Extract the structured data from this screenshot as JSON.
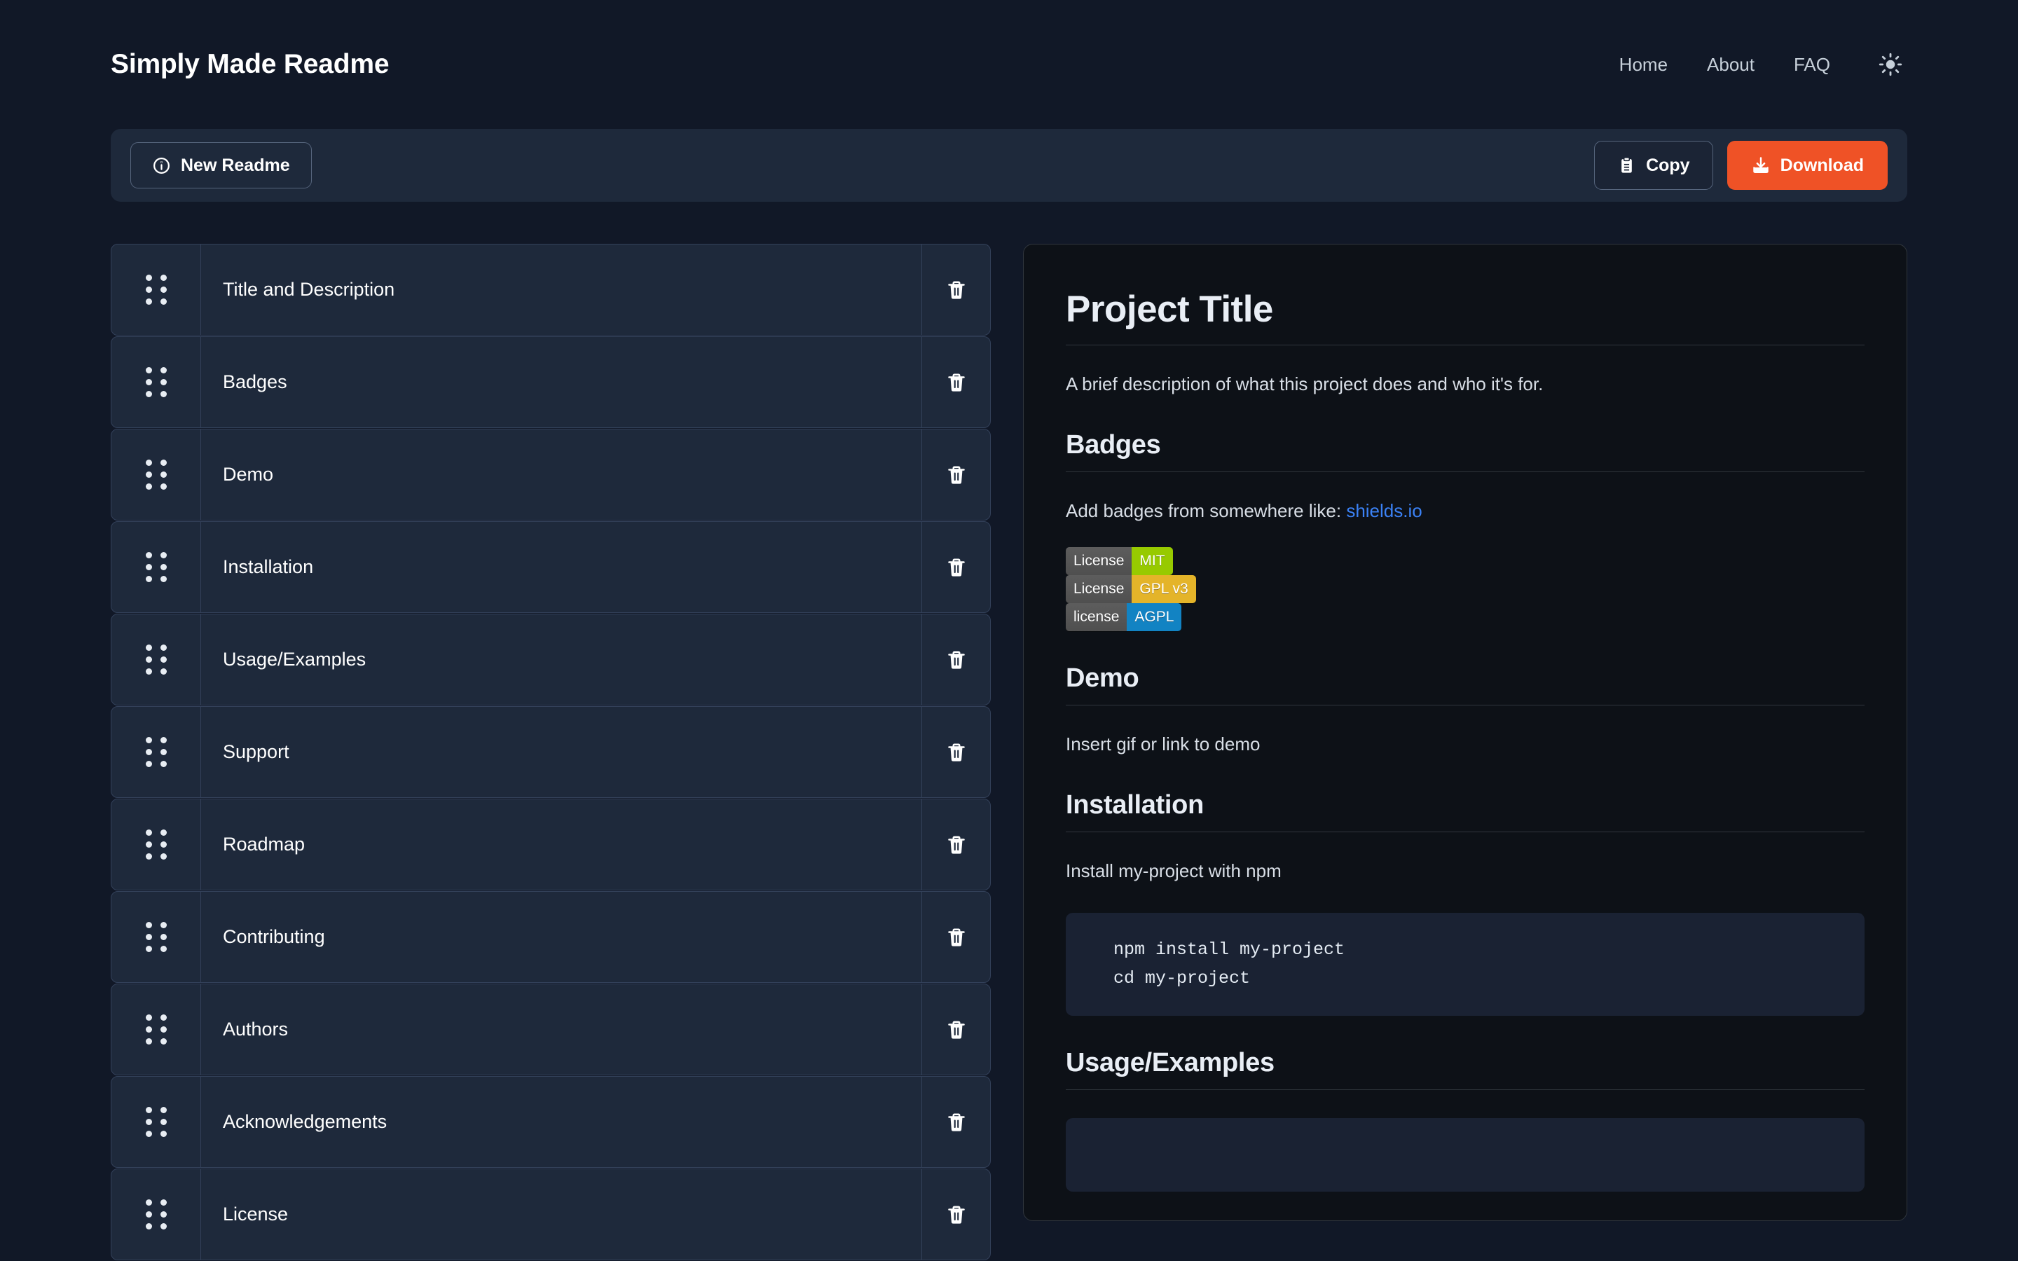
{
  "header": {
    "brand": "Simply Made Readme",
    "nav": [
      {
        "label": "Home"
      },
      {
        "label": "About"
      },
      {
        "label": "FAQ"
      }
    ],
    "theme_toggle_icon": "sun-icon"
  },
  "toolbar": {
    "new_readme_label": "New Readme",
    "new_readme_icon": "info-circle-icon",
    "copy_label": "Copy",
    "copy_icon": "clipboard-icon",
    "download_label": "Download",
    "download_icon": "download-icon",
    "accent_color": "#ef5226"
  },
  "section_list": {
    "delete_icon": "trash-icon",
    "drag_icon": "drag-handle-icon",
    "items": [
      {
        "label": "Title and Description"
      },
      {
        "label": "Badges"
      },
      {
        "label": "Demo"
      },
      {
        "label": "Installation"
      },
      {
        "label": "Usage/Examples"
      },
      {
        "label": "Support"
      },
      {
        "label": "Roadmap"
      },
      {
        "label": "Contributing"
      },
      {
        "label": "Authors"
      },
      {
        "label": "Acknowledgements"
      },
      {
        "label": "License"
      }
    ]
  },
  "preview": {
    "title": "Project Title",
    "description": "A brief description of what this project does and who it's for.",
    "badges_heading": "Badges",
    "badges_text_prefix": "Add badges from somewhere like: ",
    "badges_link": "shields.io",
    "badges": [
      {
        "left": "License",
        "right": "MIT",
        "color": "#97ca00"
      },
      {
        "left": "License",
        "right": "GPL v3",
        "color": "#e4b429"
      },
      {
        "left": "license",
        "right": "AGPL",
        "color": "#1283c3"
      }
    ],
    "demo_heading": "Demo",
    "demo_text": "Insert gif or link to demo",
    "installation_heading": "Installation",
    "installation_text": "Install my-project with npm",
    "installation_code": "  npm install my-project\n  cd my-project",
    "usage_heading": "Usage/Examples",
    "usage_code": " "
  }
}
